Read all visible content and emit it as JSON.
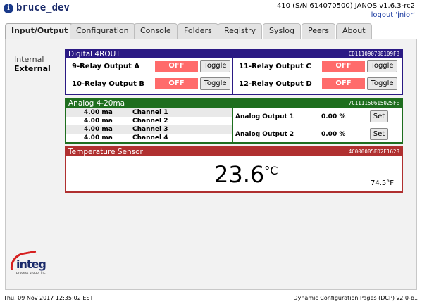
{
  "header": {
    "app_title": "bruce_dev",
    "logo_letter": "i",
    "device_info": "410 (S/N 614070500) JANOS v1.6.3-rc2",
    "logout_label": "logout 'jnior'"
  },
  "tabs": [
    {
      "label": "Input/Output",
      "active": true
    },
    {
      "label": "Configuration"
    },
    {
      "label": "Console"
    },
    {
      "label": "Folders"
    },
    {
      "label": "Registry"
    },
    {
      "label": "Syslog"
    },
    {
      "label": "Peers"
    },
    {
      "label": "About"
    }
  ],
  "side_nav": {
    "items": [
      {
        "label": "Internal"
      },
      {
        "label": "External",
        "active": true
      }
    ]
  },
  "digital": {
    "title": "Digital 4ROUT",
    "serial": "CD111090708109FB",
    "color": "#2b1a84",
    "relays": [
      {
        "label": "9-Relay Output A",
        "state": "OFF",
        "button": "Toggle"
      },
      {
        "label": "10-Relay Output B",
        "state": "OFF",
        "button": "Toggle"
      },
      {
        "label": "11-Relay Output C",
        "state": "OFF",
        "button": "Toggle"
      },
      {
        "label": "12-Relay Output D",
        "state": "OFF",
        "button": "Toggle"
      }
    ]
  },
  "analog": {
    "title": "Analog 4-20ma",
    "serial": "7C111150615025FE",
    "color": "#1e6e1e",
    "inputs": [
      {
        "value": "4.00 ma",
        "channel": "Channel 1"
      },
      {
        "value": "4.00 ma",
        "channel": "Channel 2"
      },
      {
        "value": "4.00 ma",
        "channel": "Channel 3"
      },
      {
        "value": "4.00 ma",
        "channel": "Channel 4"
      }
    ],
    "outputs": [
      {
        "label": "Analog Output 1",
        "value": "0.00 %",
        "button": "Set"
      },
      {
        "label": "Analog Output 2",
        "value": "0.00 %",
        "button": "Set"
      }
    ]
  },
  "temperature": {
    "title": "Temperature Sensor",
    "serial": "4C000005ED2E1628",
    "color": "#b03030",
    "celsius": "23.6",
    "celsius_unit": "°C",
    "fahrenheit": "74.5°F"
  },
  "brand": {
    "name": "integ",
    "subtitle": "process group, inc."
  },
  "footer": {
    "timestamp": "Thu, 09 Nov 2017 12:35:02 EST",
    "version": "Dynamic Configuration Pages (DCP) v2.0-b1"
  },
  "colors": {
    "off_state": "#ff6b6b",
    "header_text": "#1a2a6a",
    "link": "#1a3aa0"
  }
}
